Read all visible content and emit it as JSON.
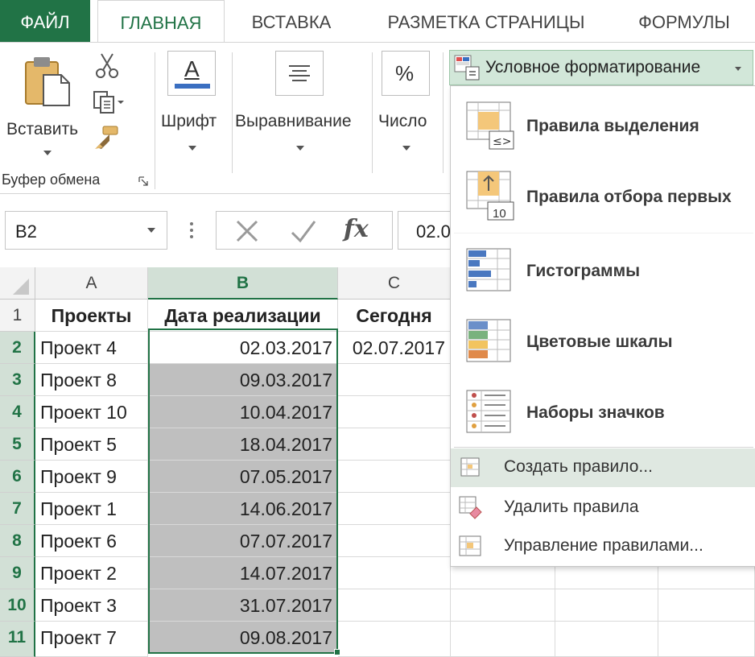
{
  "tabs": {
    "file": "ФАЙЛ",
    "home": "ГЛАВНАЯ",
    "insert": "ВСТАВКА",
    "page_layout": "РАЗМЕТКА СТРАНИЦЫ",
    "formulas": "ФОРМУЛЫ"
  },
  "ribbon": {
    "paste_label": "Вставить",
    "clipboard_group": "Буфер обмена",
    "font_label": "Шрифт",
    "alignment_label": "Выравнивание",
    "number_label": "Число",
    "font_icon_glyph": "A",
    "number_icon_glyph": "%"
  },
  "conditional_formatting": {
    "button_label": "Условное форматирование",
    "items": [
      {
        "label": "Правила выделения",
        "icon": "highlight-rules-icon"
      },
      {
        "label": "Правила отбора первых",
        "icon": "top-bottom-rules-icon",
        "badge": "10"
      },
      {
        "label": "Гистограммы",
        "icon": "data-bars-icon"
      },
      {
        "label": "Цветовые шкалы",
        "icon": "color-scales-icon"
      },
      {
        "label": "Наборы значков",
        "icon": "icon-sets-icon"
      }
    ],
    "actions": [
      {
        "label": "Создать правило...",
        "icon": "new-rule-icon"
      },
      {
        "label": "Удалить правила",
        "icon": "clear-rules-icon"
      },
      {
        "label": "Управление правилами...",
        "icon": "manage-rules-icon"
      }
    ]
  },
  "formula_bar": {
    "name_box": "B2",
    "fx": "fx",
    "value": "02.0"
  },
  "sheet": {
    "columns": [
      "A",
      "B",
      "C"
    ],
    "headers": {
      "a": "Проекты",
      "b": "Дата реализации",
      "c": "Сегодня"
    },
    "today": "02.07.2017",
    "rows": [
      {
        "num": "1"
      },
      {
        "num": "2",
        "project": "Проект 4",
        "date": "02.03.2017"
      },
      {
        "num": "3",
        "project": "Проект 8",
        "date": "09.03.2017"
      },
      {
        "num": "4",
        "project": "Проект 10",
        "date": "10.04.2017"
      },
      {
        "num": "5",
        "project": "Проект 5",
        "date": "18.04.2017"
      },
      {
        "num": "6",
        "project": "Проект 9",
        "date": "07.05.2017"
      },
      {
        "num": "7",
        "project": "Проект 1",
        "date": "14.06.2017"
      },
      {
        "num": "8",
        "project": "Проект 6",
        "date": "07.07.2017"
      },
      {
        "num": "9",
        "project": "Проект 2",
        "date": "14.07.2017"
      },
      {
        "num": "10",
        "project": "Проект 3",
        "date": "31.07.2017"
      },
      {
        "num": "11",
        "project": "Проект 7",
        "date": "09.08.2017"
      }
    ]
  },
  "colors": {
    "excel_green": "#217346",
    "selection_fill": "#bfbfbf",
    "header_selected": "#d2e0d6"
  }
}
